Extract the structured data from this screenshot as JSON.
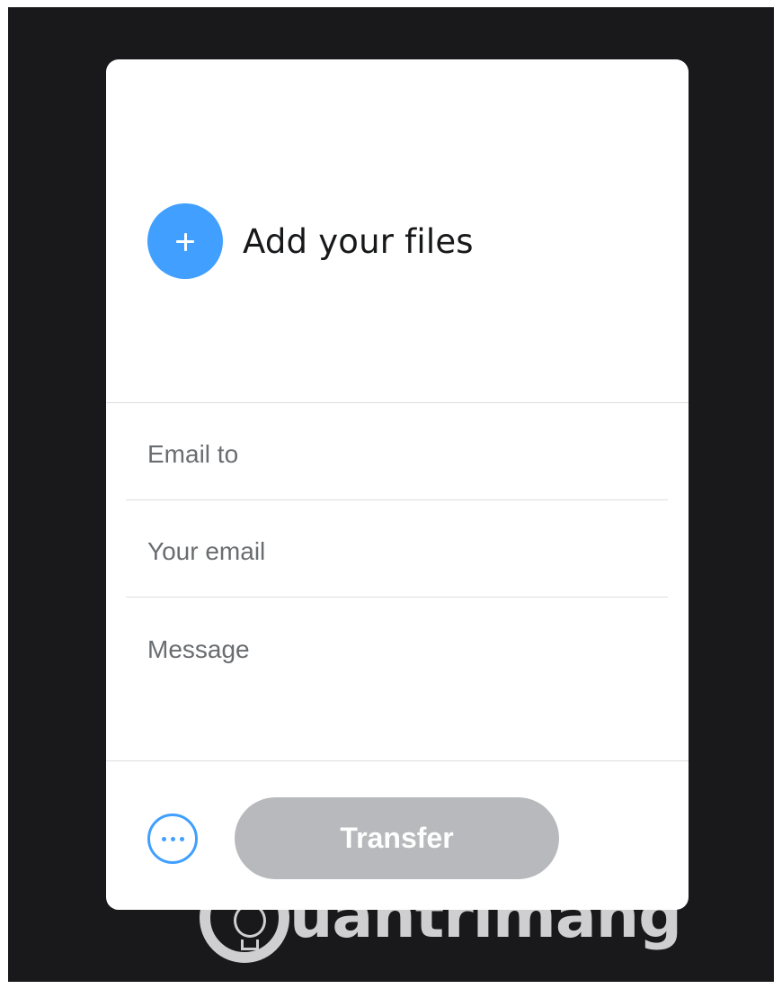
{
  "upload": {
    "label": "Add your files",
    "icon": "plus-icon",
    "accent_color": "#409fff"
  },
  "form": {
    "email_to": {
      "placeholder": "Email to",
      "value": ""
    },
    "your_email": {
      "placeholder": "Your email",
      "value": ""
    },
    "message": {
      "placeholder": "Message",
      "value": ""
    }
  },
  "actions": {
    "more_icon": "more-horizontal-icon",
    "transfer_label": "Transfer",
    "transfer_color": "#b8b9bc"
  },
  "watermark": {
    "text": "uantrimang",
    "logo_icon": "lightbulb-icon"
  }
}
